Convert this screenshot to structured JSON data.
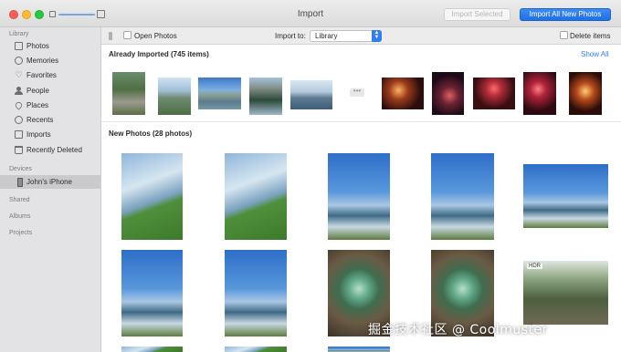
{
  "window": {
    "title": "Import",
    "import_selected_label": "Import Selected",
    "import_all_label": "Import All New Photos"
  },
  "sidebar": {
    "library_header": "Library",
    "library_items": [
      {
        "label": "Photos",
        "icon": "photos-icon"
      },
      {
        "label": "Memories",
        "icon": "memories-icon"
      },
      {
        "label": "Favorites",
        "icon": "heart-icon"
      },
      {
        "label": "People",
        "icon": "person-icon"
      },
      {
        "label": "Places",
        "icon": "pin-icon"
      },
      {
        "label": "Recents",
        "icon": "clock-icon"
      },
      {
        "label": "Imports",
        "icon": "import-icon"
      },
      {
        "label": "Recently Deleted",
        "icon": "trash-icon"
      }
    ],
    "devices_header": "Devices",
    "device": {
      "label": "John's iPhone",
      "icon": "iphone-icon"
    },
    "shared_header": "Shared",
    "albums_header": "Albums",
    "projects_header": "Projects"
  },
  "toolbar": {
    "open_photos_label": "Open Photos",
    "open_photos_checked": false,
    "import_to_label": "Import to:",
    "import_to_value": "Library",
    "delete_items_label": "Delete items",
    "delete_items_checked": false
  },
  "already_imported": {
    "title": "Already Imported (745 items)",
    "show_all_label": "Show All",
    "more_indicator": "•••"
  },
  "new_photos": {
    "title": "New Photos (28 photos)",
    "hdr_badge": "HDR"
  },
  "watermark": "掘金技术社区 @ Coolmuster"
}
